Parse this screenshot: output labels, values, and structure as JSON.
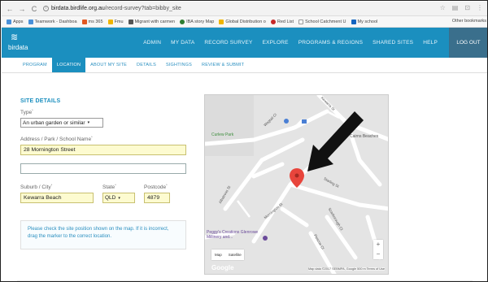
{
  "browser": {
    "nav_back": "←",
    "nav_forward": "→",
    "nav_reload": "C",
    "url_host": "birdata.birdlife.org.au",
    "url_path": "/record-survey?tab=bibby_site",
    "right_icons": [
      "☆",
      "▤",
      "⊡",
      "⋮"
    ],
    "bookmarks": [
      {
        "label": "Apps",
        "color": "#4a90d9"
      },
      {
        "label": "Teamwork - Dashboa",
        "color": "#4a90d9"
      },
      {
        "label": "ms 365",
        "color": "#e25822"
      },
      {
        "label": "Fmu",
        "color": "#f0b400"
      },
      {
        "label": "Migrant with carmen",
        "color": "#555555"
      },
      {
        "label": "IBA story Map",
        "color": "#2e7d32"
      },
      {
        "label": "Global Distribution o",
        "color": "#f0b400"
      },
      {
        "label": "Red List",
        "color": "#c62828"
      },
      {
        "label": "School Catchment U",
        "color": "#999999"
      },
      {
        "label": "My school",
        "color": "#1565c0"
      }
    ],
    "other_bookmarks": "Other bookmarks"
  },
  "header": {
    "logo_text": "birdata",
    "nav": [
      "ADMIN",
      "MY DATA",
      "RECORD SURVEY",
      "EXPLORE",
      "PROGRAMS & REGIONS",
      "SHARED SITES",
      "HELP"
    ],
    "logout": "LOG OUT"
  },
  "tabs": [
    {
      "label": "PROGRAM",
      "active": false
    },
    {
      "label": "LOCATION",
      "active": true
    },
    {
      "label": "ABOUT MY SITE",
      "active": false
    },
    {
      "label": "DETAILS",
      "active": false
    },
    {
      "label": "SIGHTINGS",
      "active": false
    },
    {
      "label": "REVIEW & SUBMIT",
      "active": false
    }
  ],
  "form": {
    "title": "SITE DETAILS",
    "type_label": "Type",
    "type_value": "An urban garden or similar",
    "address_label": "Address / Park / School Name",
    "address_value": "28 Mornington Street",
    "address2_value": "",
    "suburb_label": "Suburb / City",
    "suburb_value": "Kewarra Beach",
    "state_label": "State",
    "state_value": "QLD",
    "postcode_label": "Postcode",
    "postcode_value": "4879",
    "info_text": "Please check the site position shown on the map. If it is incorrect, drag the marker to the correct location."
  },
  "map": {
    "streets": [
      "Kewarra St",
      "Wagtail Cl",
      "Curlew Park",
      "Cairns Beaches",
      "Starling St",
      "Albatross St",
      "Mornington St",
      "Scarborough Cl",
      "Pascoe Cl"
    ],
    "poi_text": "Peggy's Creations Glenrowe Millinery and...",
    "maptype": [
      "Map",
      "Satellite"
    ],
    "zoom": [
      "+",
      "−"
    ],
    "brand": "Google",
    "attribution": "Map data ©2017 SEBMPA, Google  500 m     Terms of Use",
    "colors": {
      "road": "#ffffff",
      "land": "#e4e4e4",
      "pin": "#e8453c",
      "arrow": "#111111"
    }
  }
}
